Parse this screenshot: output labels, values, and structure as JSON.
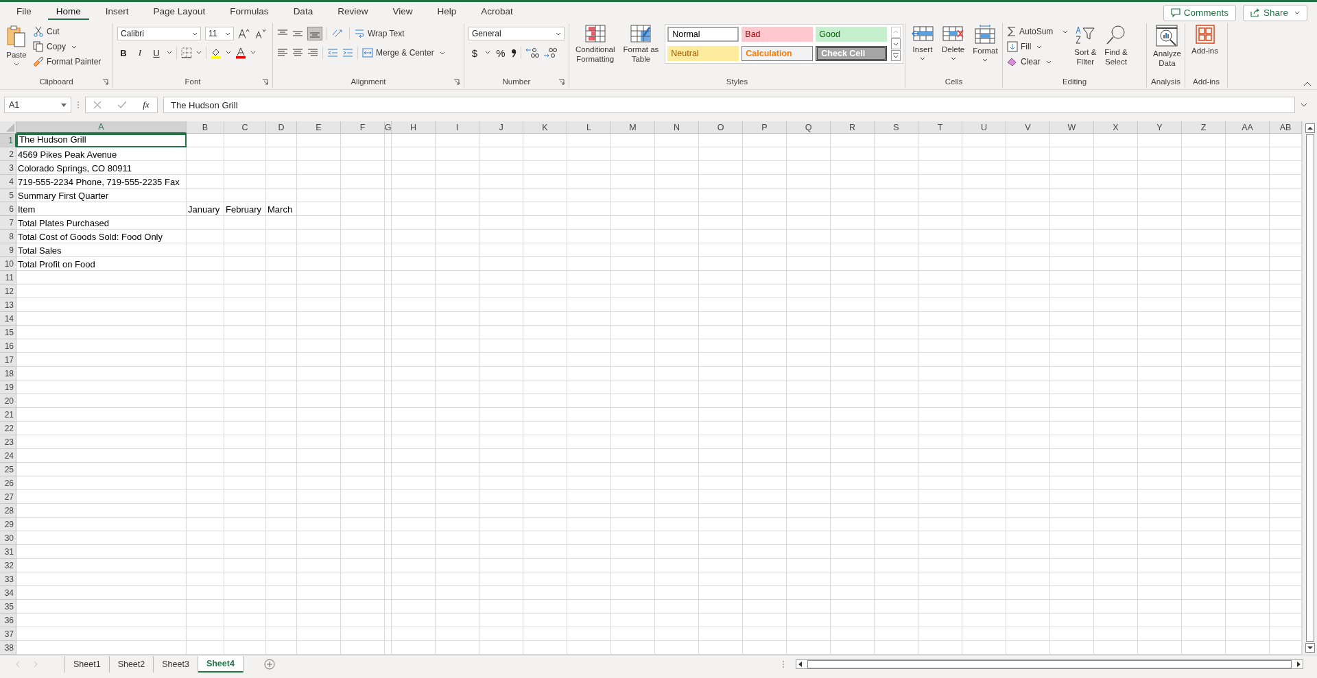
{
  "menu_tabs": [
    {
      "label": "File",
      "selected": false
    },
    {
      "label": "Home",
      "selected": true
    },
    {
      "label": "Insert",
      "selected": false
    },
    {
      "label": "Page Layout",
      "selected": false
    },
    {
      "label": "Formulas",
      "selected": false
    },
    {
      "label": "Data",
      "selected": false
    },
    {
      "label": "Review",
      "selected": false
    },
    {
      "label": "View",
      "selected": false
    },
    {
      "label": "Help",
      "selected": false
    },
    {
      "label": "Acrobat",
      "selected": false
    }
  ],
  "header_buttons": {
    "comments": "Comments",
    "share": "Share"
  },
  "ribbon": {
    "clipboard": {
      "label": "Clipboard",
      "paste": "Paste",
      "cut": "Cut",
      "copy": "Copy",
      "format_painter": "Format Painter"
    },
    "font": {
      "label": "Font",
      "family": "Calibri",
      "size": "11",
      "bold": "B",
      "italic": "I",
      "underline": "U"
    },
    "alignment": {
      "label": "Alignment",
      "bottom_align_on": true,
      "wrap_text": "Wrap Text",
      "merge": "Merge & Center"
    },
    "number": {
      "label": "Number",
      "format": "General",
      "currency": "$",
      "percent": "%"
    },
    "styles": {
      "label": "Styles",
      "conditional": [
        "Conditional",
        "Formatting"
      ],
      "format_table": [
        "Format as",
        "Table"
      ],
      "gallery": [
        {
          "name": "Normal",
          "kind": "normal"
        },
        {
          "name": "Bad",
          "kind": "bad"
        },
        {
          "name": "Good",
          "kind": "good"
        },
        {
          "name": "Neutral",
          "kind": "neutral"
        },
        {
          "name": "Calculation",
          "kind": "calculation"
        },
        {
          "name": "Check Cell",
          "kind": "check"
        }
      ]
    },
    "cells": {
      "label": "Cells",
      "insert": "Insert",
      "delete": "Delete",
      "format": "Format"
    },
    "editing": {
      "label": "Editing",
      "autosum": "AutoSum",
      "fill": "Fill",
      "clear": "Clear",
      "sort": [
        "Sort &",
        "Filter"
      ],
      "find": [
        "Find &",
        "Select"
      ]
    },
    "analysis": {
      "label": "Analysis",
      "analyze": [
        "Analyze",
        "Data"
      ]
    },
    "addins": {
      "label": "Add-ins",
      "addins": "Add-ins"
    }
  },
  "formula_bar": {
    "name_box": "A1",
    "fx": "fx",
    "value": "The Hudson Grill"
  },
  "columns": [
    {
      "label": "A",
      "selected": true
    },
    {
      "label": "B",
      "selected": false
    },
    {
      "label": "C",
      "selected": false
    },
    {
      "label": "D",
      "selected": false
    },
    {
      "label": "E",
      "selected": false
    },
    {
      "label": "F",
      "selected": false
    },
    {
      "label": "G",
      "selected": false
    },
    {
      "label": "H",
      "selected": false
    },
    {
      "label": "I",
      "selected": false
    },
    {
      "label": "J",
      "selected": false
    },
    {
      "label": "K",
      "selected": false
    },
    {
      "label": "L",
      "selected": false
    },
    {
      "label": "M",
      "selected": false
    },
    {
      "label": "N",
      "selected": false
    },
    {
      "label": "O",
      "selected": false
    },
    {
      "label": "P",
      "selected": false
    },
    {
      "label": "Q",
      "selected": false
    },
    {
      "label": "R",
      "selected": false
    },
    {
      "label": "S",
      "selected": false
    },
    {
      "label": "T",
      "selected": false
    },
    {
      "label": "U",
      "selected": false
    },
    {
      "label": "V",
      "selected": false
    },
    {
      "label": "W",
      "selected": false
    },
    {
      "label": "X",
      "selected": false
    },
    {
      "label": "Y",
      "selected": false
    },
    {
      "label": "Z",
      "selected": false
    },
    {
      "label": "AA",
      "selected": false
    },
    {
      "label": "AB",
      "selected": false
    }
  ],
  "rows": [
    {
      "label": "1",
      "selected": true,
      "cells": [
        "The Hudson Grill"
      ]
    },
    {
      "label": "2",
      "selected": false,
      "cells": [
        "4569 Pikes Peak Avenue"
      ]
    },
    {
      "label": "3",
      "selected": false,
      "cells": [
        "Colorado Springs, CO 80911"
      ]
    },
    {
      "label": "4",
      "selected": false,
      "cells": [
        "719-555-2234 Phone, 719-555-2235 Fax"
      ]
    },
    {
      "label": "5",
      "selected": false,
      "cells": [
        "Summary First Quarter"
      ]
    },
    {
      "label": "6",
      "selected": false,
      "cells": [
        "Item",
        "January",
        "February",
        "March"
      ]
    },
    {
      "label": "7",
      "selected": false,
      "cells": [
        "Total Plates Purchased"
      ]
    },
    {
      "label": "8",
      "selected": false,
      "cells": [
        "Total Cost of Goods Sold: Food Only"
      ]
    },
    {
      "label": "9",
      "selected": false,
      "cells": [
        "Total Sales"
      ]
    },
    {
      "label": "10",
      "selected": false,
      "cells": [
        "Total Profit on Food"
      ]
    },
    {
      "label": "11",
      "selected": false
    },
    {
      "label": "12",
      "selected": false
    },
    {
      "label": "13",
      "selected": false
    },
    {
      "label": "14",
      "selected": false
    },
    {
      "label": "15",
      "selected": false
    },
    {
      "label": "16",
      "selected": false
    },
    {
      "label": "17",
      "selected": false
    },
    {
      "label": "18",
      "selected": false
    },
    {
      "label": "19",
      "selected": false
    },
    {
      "label": "20",
      "selected": false
    },
    {
      "label": "21",
      "selected": false
    },
    {
      "label": "22",
      "selected": false
    },
    {
      "label": "23",
      "selected": false
    },
    {
      "label": "24",
      "selected": false
    },
    {
      "label": "25",
      "selected": false
    },
    {
      "label": "26",
      "selected": false
    },
    {
      "label": "27",
      "selected": false
    },
    {
      "label": "28",
      "selected": false
    },
    {
      "label": "29",
      "selected": false
    },
    {
      "label": "30",
      "selected": false
    },
    {
      "label": "31",
      "selected": false
    },
    {
      "label": "32",
      "selected": false
    },
    {
      "label": "33",
      "selected": false
    },
    {
      "label": "34",
      "selected": false
    },
    {
      "label": "35",
      "selected": false
    },
    {
      "label": "36",
      "selected": false
    },
    {
      "label": "37",
      "selected": false
    },
    {
      "label": "38",
      "selected": false
    }
  ],
  "sheet_tabs": [
    {
      "label": "Sheet1",
      "selected": false
    },
    {
      "label": "Sheet2",
      "selected": false
    },
    {
      "label": "Sheet3",
      "selected": false
    },
    {
      "label": "Sheet4",
      "selected": true
    }
  ]
}
